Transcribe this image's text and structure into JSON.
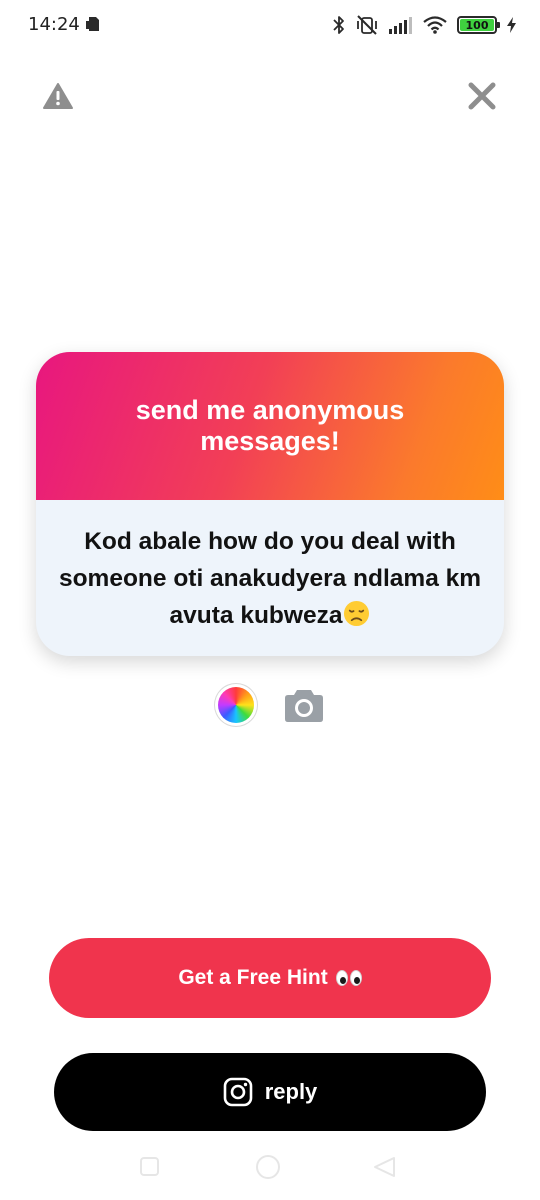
{
  "status_bar": {
    "time": "14:24",
    "battery_level": "100"
  },
  "card": {
    "title": "send me anonymous messages!",
    "message": "Kod abale how do you deal with someone oti anakudyera ndlama km avuta kubweza",
    "message_emoji": "disappointed-face"
  },
  "buttons": {
    "hint_label": "Get a Free Hint",
    "hint_emoji": "eyes",
    "reply_label": "reply",
    "reply_icon": "instagram-icon"
  },
  "colors": {
    "gradient_start": "#e8177f",
    "gradient_end": "#ff8d17",
    "hint_button": "#f0344d",
    "reply_button": "#000000",
    "card_body": "#eef4fb"
  }
}
